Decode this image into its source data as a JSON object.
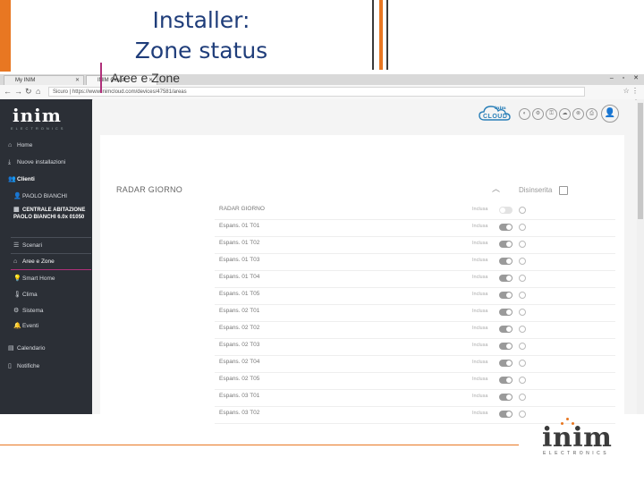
{
  "slide": {
    "title_line1": "Installer:",
    "title_line2": "Zone status"
  },
  "browser": {
    "tabs": [
      {
        "label": "My INIM"
      },
      {
        "label": "INIM Cloud"
      }
    ],
    "url": "Sicuro | https://www.inimcloud.com/devices/47581/areas"
  },
  "sidebar": {
    "logo": "inim",
    "logo_sub": "ELECTRONICS",
    "items": [
      {
        "label": "Home"
      },
      {
        "label": "Nuove installazioni"
      },
      {
        "label": "Clienti"
      },
      {
        "label": "PAOLO BIANCHI"
      },
      {
        "label": "CENTRALE ABITAZIONE PAOLO BIANCHI 6.0x 01050"
      },
      {
        "label": "Scenari"
      },
      {
        "label": "Aree e Zone"
      },
      {
        "label": "Smart Home"
      },
      {
        "label": "Clima"
      },
      {
        "label": "Sistema"
      },
      {
        "label": "Eventi"
      },
      {
        "label": "Calendario"
      },
      {
        "label": "Notifiche"
      }
    ]
  },
  "header": {
    "cloud_top": "inim",
    "cloud_text": "CLOUD"
  },
  "page": {
    "title": "Aree e Zone"
  },
  "area": {
    "name": "RADAR GIORNO",
    "state": "Disinserita"
  },
  "zones": [
    {
      "name": "RADAR GIORNO",
      "status": "Inclusa",
      "on": false
    },
    {
      "name": "Espans. 01 T01",
      "status": "Inclusa",
      "on": true
    },
    {
      "name": "Espans. 01 T02",
      "status": "Inclusa",
      "on": true
    },
    {
      "name": "Espans. 01 T03",
      "status": "Inclusa",
      "on": true
    },
    {
      "name": "Espans. 01 T04",
      "status": "Inclusa",
      "on": true
    },
    {
      "name": "Espans. 01 T05",
      "status": "Inclusa",
      "on": true
    },
    {
      "name": "Espans. 02 T01",
      "status": "Inclusa",
      "on": true
    },
    {
      "name": "Espans. 02 T02",
      "status": "Inclusa",
      "on": true
    },
    {
      "name": "Espans. 02 T03",
      "status": "Inclusa",
      "on": true
    },
    {
      "name": "Espans. 02 T04",
      "status": "Inclusa",
      "on": true
    },
    {
      "name": "Espans. 02 T05",
      "status": "Inclusa",
      "on": true
    },
    {
      "name": "Espans. 03 T01",
      "status": "Inclusa",
      "on": true
    },
    {
      "name": "Espans. 03 T02",
      "status": "Inclusa",
      "on": true
    }
  ],
  "footer": {
    "logo": "inim",
    "sub": "ELECTRONICS"
  },
  "colors": {
    "accent_orange": "#e87722",
    "accent_magenta": "#b0307a",
    "sidebar_bg": "#2b2f36",
    "title_blue": "#1f3d7a"
  }
}
